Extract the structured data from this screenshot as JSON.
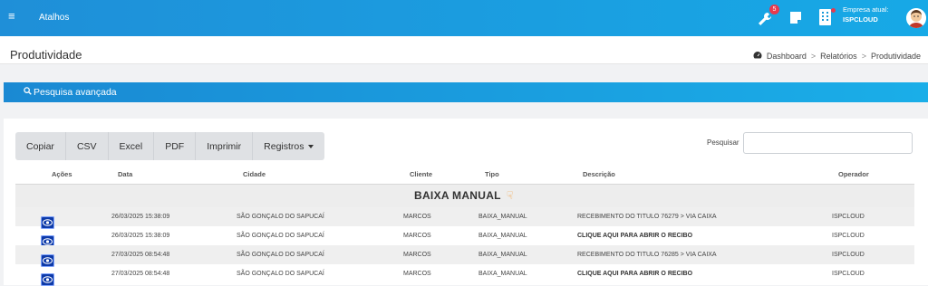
{
  "topbar": {
    "menu_icon": "hamburger-icon",
    "menu_glyph": "≡",
    "shortcut_label": "Atalhos",
    "notifications_count": "5",
    "company_label": "Empresa atual:",
    "company_value": "ISPCLOUD",
    "colors": {
      "bar_start": "#1f8fd8",
      "bar_end": "#17a9e6",
      "badge": "#e8394d"
    }
  },
  "page": {
    "title": "Produtividade",
    "breadcrumb": [
      "Dashboard",
      "Relatórios",
      "Produtividade"
    ],
    "breadcrumb_sep": ">"
  },
  "advanced_search": {
    "label": "Pesquisa avançada"
  },
  "toolbar": {
    "buttons": [
      "Copiar",
      "CSV",
      "Excel",
      "PDF",
      "Imprimir",
      "Registros"
    ],
    "search_label": "Pesquisar",
    "search_value": ""
  },
  "table": {
    "columns": [
      "Ações",
      "Data",
      "Cidade",
      "Cliente",
      "Tipo",
      "Descrição",
      "Operador"
    ],
    "group_label": "BAIXA MANUAL",
    "group_icon": "pointing-hand-icon",
    "rows": [
      {
        "data": "26/03/2025 15:38:09",
        "cidade": "SÃO GONÇALO DO SAPUCAÍ",
        "cliente": "MARCOS",
        "tipo": "BAIXA_MANUAL",
        "descricao": "RECEBIMENTO DO TITULO 76279 > VIA CAIXA",
        "operador": "ISPCLOUD"
      },
      {
        "data": "26/03/2025 15:38:09",
        "cidade": "SÃO GONÇALO DO SAPUCAÍ",
        "cliente": "MARCOS",
        "tipo": "BAIXA_MANUAL",
        "descricao": "CLIQUE AQUI PARA ABRIR O RECIBO",
        "operador": "ISPCLOUD"
      },
      {
        "data": "27/03/2025 08:54:48",
        "cidade": "SÃO GONÇALO DO SAPUCAÍ",
        "cliente": "MARCOS",
        "tipo": "BAIXA_MANUAL",
        "descricao": "RECEBIMENTO DO TITULO 76285 > VIA CAIXA",
        "operador": "ISPCLOUD"
      },
      {
        "data": "27/03/2025 08:54:48",
        "cidade": "SÃO GONÇALO DO SAPUCAÍ",
        "cliente": "MARCOS",
        "tipo": "BAIXA_MANUAL",
        "descricao": "CLIQUE AQUI PARA ABRIR O RECIBO",
        "operador": "ISPCLOUD"
      }
    ],
    "row_actions": [
      "user-icon",
      "eye-icon",
      "view-icon"
    ]
  }
}
